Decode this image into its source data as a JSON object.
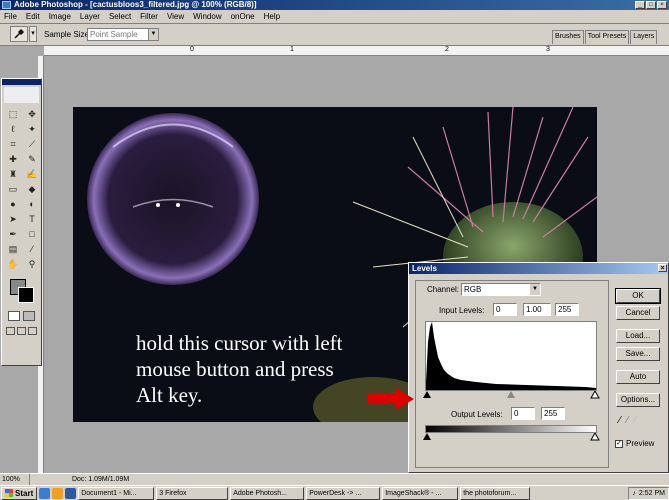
{
  "window": {
    "title": "Adobe Photoshop - [cactusbloos3_filtered.jpg @ 100% (RGB/8)]"
  },
  "menu": [
    "File",
    "Edit",
    "Image",
    "Layer",
    "Select",
    "Filter",
    "View",
    "Window",
    "onOne",
    "Help"
  ],
  "options": {
    "sample_size_label": "Sample Size:",
    "sample_size_value": "Point Sample"
  },
  "palette_tabs": [
    "Brushes",
    "Tool Presets",
    "Layers"
  ],
  "rulers": {
    "top_marks": [
      "0",
      "1",
      "2",
      "3"
    ]
  },
  "canvas": {
    "overlay_text": "hold this cursor with left\nmouse button and press\nAlt key."
  },
  "levels": {
    "title": "Levels",
    "channel_label": "Channel:",
    "channel_value": "RGB",
    "input_label": "Input Levels:",
    "input_black": "0",
    "input_gamma": "1.00",
    "input_white": "255",
    "output_label": "Output Levels:",
    "output_black": "0",
    "output_white": "255",
    "buttons": {
      "ok": "OK",
      "cancel": "Cancel",
      "load": "Load...",
      "save": "Save...",
      "auto": "Auto",
      "options": "Options..."
    },
    "preview_label": "Preview",
    "preview_checked": true
  },
  "status": {
    "zoom": "100%",
    "doc": "Doc: 1.09M/1.09M"
  },
  "taskbar": {
    "start": "Start",
    "tasks": [
      "Document1 - Mi...",
      "3 Firefox",
      "Adobe Photosh...",
      "PowerDesk -> ...",
      "ImageShack® - ...",
      "the photoforum..."
    ],
    "clock": "2:52 PM"
  },
  "colors": {
    "title_blue": "#0a246a",
    "arrow_red": "#e00000",
    "chrome": "#d4d0c8"
  },
  "icons": [
    "eyedropper-icon",
    "marquee-icon",
    "move-icon",
    "lasso-icon",
    "magic-wand-icon",
    "crop-icon",
    "slice-icon",
    "healing-icon",
    "brush-icon",
    "stamp-icon",
    "history-brush-icon",
    "eraser-icon",
    "bucket-icon",
    "blur-icon",
    "dodge-icon",
    "pen-icon",
    "type-icon",
    "path-select-icon",
    "shape-icon",
    "notes-icon",
    "eyedropper-tool-icon",
    "hand-icon",
    "zoom-icon",
    "red-arrow-icon"
  ]
}
